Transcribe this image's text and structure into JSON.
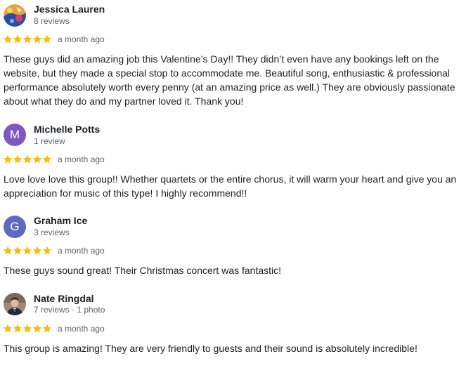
{
  "reviews": [
    {
      "name": "Jessica Lauren",
      "meta": "8 reviews",
      "avatar": {
        "type": "photo",
        "icon": "user-photo-icon"
      },
      "rating": 5,
      "date": "a month ago",
      "text": "These guys did an amazing job this Valentine’s Day!! They didn’t even have any bookings left on the website, but they made a special stop to accommodate me. Beautiful song, enthusiastic & professional performance absolutely worth every penny (at an amazing price as well.) They are obviously passionate about what they do and my partner loved it. Thank you!"
    },
    {
      "name": "Michelle Potts",
      "meta": "1 review",
      "avatar": {
        "type": "letter",
        "letter": "M",
        "color": "#7e57c2"
      },
      "rating": 5,
      "date": "a month ago",
      "text": "Love love love this group!! Whether quartets or the entire chorus, it will warm your heart and give you an appreciation for music of this type! I highly recommend!!"
    },
    {
      "name": "Graham Ice",
      "meta": "3 reviews",
      "avatar": {
        "type": "letter",
        "letter": "G",
        "color": "#5c6bc0"
      },
      "rating": 5,
      "date": "a month ago",
      "text": "These guys sound great! Their Christmas concert was fantastic!"
    },
    {
      "name": "Nate Ringdal",
      "meta": "7 reviews · 1 photo",
      "avatar": {
        "type": "photo",
        "icon": "user-photo-icon"
      },
      "rating": 5,
      "date": "a month ago",
      "text": "This group is amazing! They are very friendly to guests and their sound is absolutely incredible!"
    }
  ],
  "colors": {
    "star": "#fbbc04",
    "name": "#202124",
    "meta": "#5f6368",
    "text": "#202124"
  }
}
